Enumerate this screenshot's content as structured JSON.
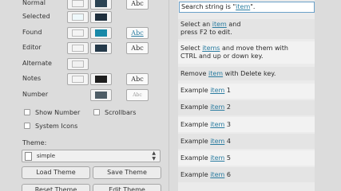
{
  "colors": {
    "normal": [
      "#f4f4f4",
      "#2b4353"
    ],
    "selected": [
      "#eef8fb",
      "#1f2f3d"
    ],
    "found": [
      "#f4f4f4",
      "#1889a8"
    ],
    "editor": [
      "#f4f4f4",
      "#253a4a"
    ],
    "alternate": [
      "#f1f1f1"
    ],
    "notes": [
      "#f4f4f4",
      "#1d1d1d"
    ],
    "number": [
      "#4e5d66"
    ]
  },
  "rows": {
    "normal": {
      "label": "Normal",
      "abc": "Abc"
    },
    "selected": {
      "label": "Selected"
    },
    "found": {
      "label": "Found",
      "abc": "Abc"
    },
    "editor": {
      "label": "Editor",
      "abc": "Abc"
    },
    "alternate": {
      "label": "Alternate"
    },
    "notes": {
      "label": "Notes",
      "abc": "Abc"
    },
    "number": {
      "label": "Number",
      "abc": "Abc"
    }
  },
  "options": {
    "show_number": "Show Number",
    "scrollbars": "Scrollbars",
    "system_icons": "System Icons"
  },
  "theme": {
    "label": "Theme:",
    "value": "simple",
    "arrows": "▲▼"
  },
  "buttons": {
    "load_theme": "Load Theme",
    "save_theme": "Save Theme",
    "reset_theme": "Reset Theme",
    "edit_theme": "Edit Theme"
  },
  "preview": {
    "search_prefix": "Search string is \"",
    "search_term": "item",
    "search_suffix": "\".",
    "line1_a": "Select an ",
    "line1_b": "item",
    "line1_c": " and",
    "line1_d": "press F2 to edit.",
    "line2_a": "Select ",
    "line2_b": "items",
    "line2_c": " and move them with",
    "line2_d": "CTRL and up or down key.",
    "line3_a": "Remove ",
    "line3_b": "item",
    "line3_c": " with Delete key.",
    "example_prefix": "Example ",
    "example_word": "item",
    "examples": [
      "1",
      "2",
      "3",
      "4",
      "5",
      "6"
    ]
  }
}
